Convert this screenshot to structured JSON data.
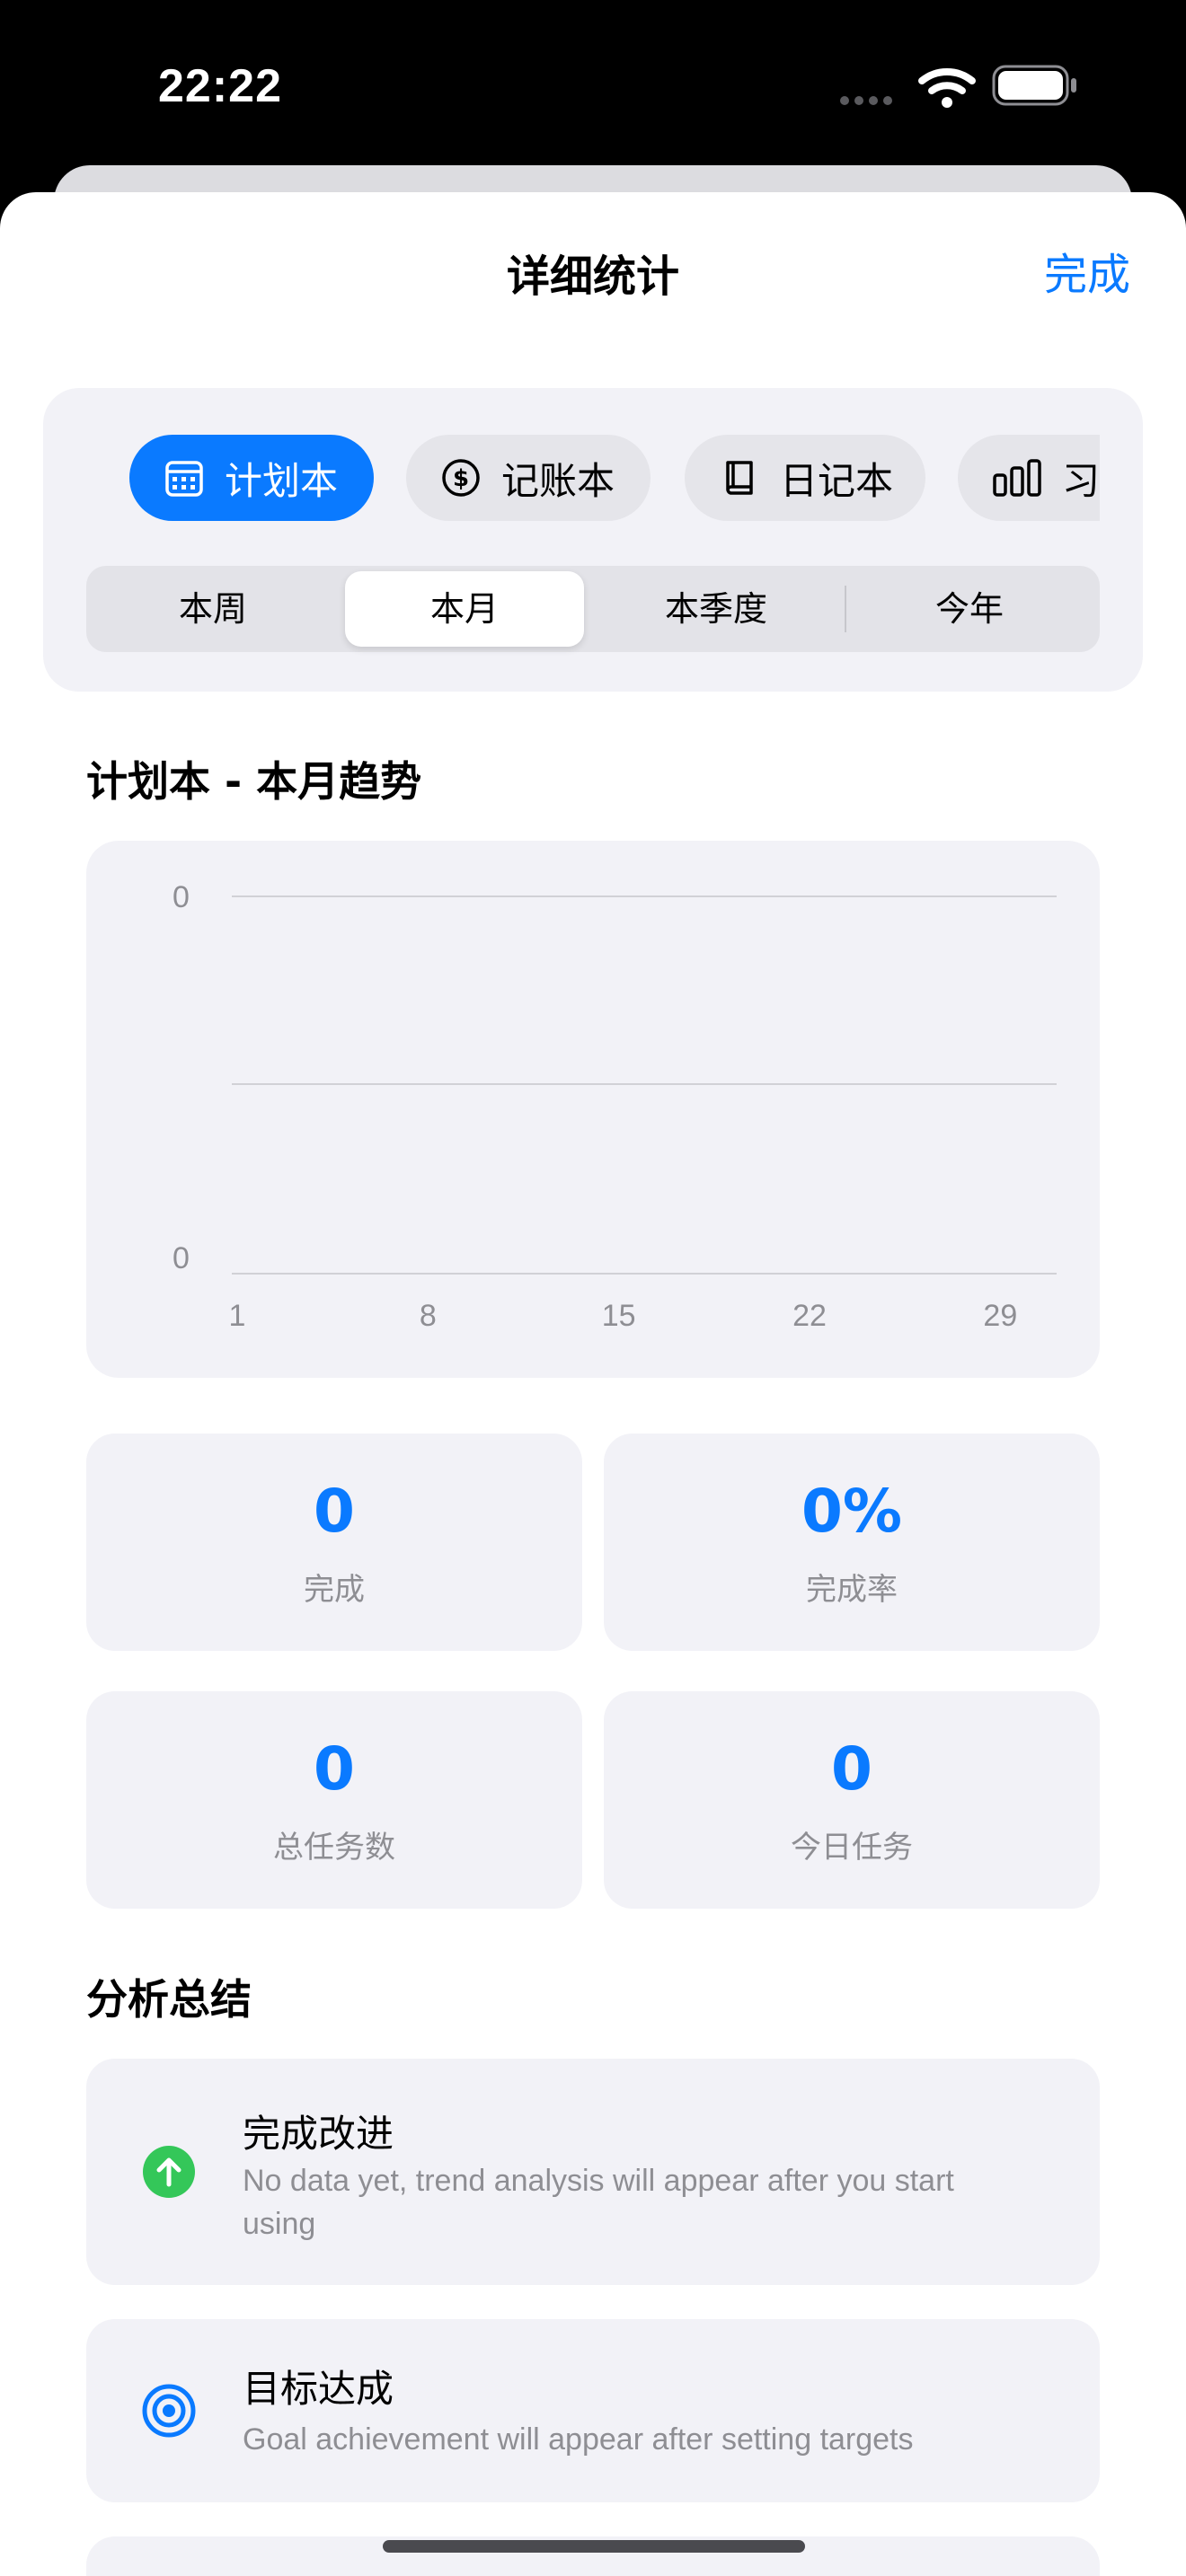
{
  "status_bar": {
    "time": "22:22",
    "icons": [
      "cellular-dots-icon",
      "wifi-icon",
      "battery-icon"
    ]
  },
  "nav": {
    "title": "详细统计",
    "done_label": "完成"
  },
  "categories": [
    {
      "label": "计划本",
      "icon": "calendar-icon",
      "active": true
    },
    {
      "label": "记账本",
      "icon": "dollar-circle-icon",
      "active": false
    },
    {
      "label": "日记本",
      "icon": "book-icon",
      "active": false
    },
    {
      "label": "习",
      "icon": "bar-chart-icon",
      "active": false
    }
  ],
  "periods": [
    {
      "label": "本周",
      "selected": false
    },
    {
      "label": "本月",
      "selected": true
    },
    {
      "label": "本季度",
      "selected": false
    },
    {
      "label": "今年",
      "selected": false
    }
  ],
  "trend_title": "计划本 - 本月趋势",
  "chart_data": {
    "type": "line",
    "x": [
      1,
      8,
      15,
      22,
      29
    ],
    "x_tick_labels": [
      "1",
      "8",
      "15",
      "22",
      "29"
    ],
    "y_tick_labels": [
      "0",
      "0"
    ],
    "series": [],
    "ylim": [
      0,
      0
    ],
    "grid": true
  },
  "stats": [
    {
      "value": "0",
      "label": "完成"
    },
    {
      "value": "0%",
      "label": "完成率"
    },
    {
      "value": "0",
      "label": "总任务数"
    },
    {
      "value": "0",
      "label": "今日任务"
    }
  ],
  "analysis": {
    "title": "分析总结",
    "items": [
      {
        "title": "完成改进",
        "desc": "No data yet, trend analysis will appear after you start using",
        "icon": "arrow-up-circle-icon",
        "icon_color": "#34c759"
      },
      {
        "title": "目标达成",
        "desc": "Goal achievement will appear after setting targets",
        "icon": "target-icon",
        "icon_color": "#0a7aff"
      }
    ]
  },
  "colors": {
    "accent": "#0a7aff",
    "success": "#34c759",
    "card_background": "#f2f2f7",
    "secondary_text": "#8e8e93"
  }
}
